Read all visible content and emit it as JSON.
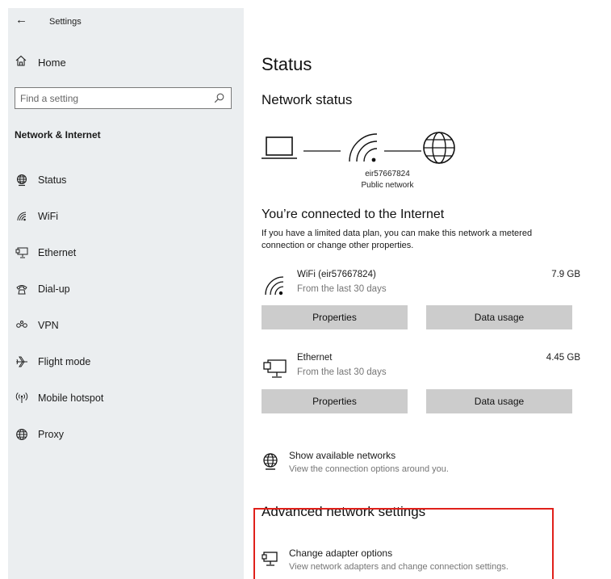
{
  "app": {
    "title": "Settings",
    "accent": "#e0201b"
  },
  "sidebar": {
    "home_label": "Home",
    "search_placeholder": "Find a setting",
    "section_title": "Network & Internet",
    "items": [
      {
        "label": "Status",
        "icon": "globe-status-icon"
      },
      {
        "label": "WiFi",
        "icon": "wifi-icon"
      },
      {
        "label": "Ethernet",
        "icon": "ethernet-icon"
      },
      {
        "label": "Dial-up",
        "icon": "phone-icon"
      },
      {
        "label": "VPN",
        "icon": "vpn-icon"
      },
      {
        "label": "Flight mode",
        "icon": "airplane-icon"
      },
      {
        "label": "Mobile hotspot",
        "icon": "hotspot-icon"
      },
      {
        "label": "Proxy",
        "icon": "globe-icon"
      }
    ]
  },
  "main": {
    "title": "Status",
    "network_status_heading": "Network status",
    "network_name": "eir57667824",
    "network_type": "Public network",
    "connected_heading": "You’re connected to the Internet",
    "connected_desc": "If you have a limited data plan, you can make this network a metered connection or change other properties.",
    "adapters": [
      {
        "name": "WiFi (eir57667824)",
        "sub": "From the last 30 days",
        "size": "7.9 GB",
        "icon": "wifi-icon",
        "properties_label": "Properties",
        "data_usage_label": "Data usage"
      },
      {
        "name": "Ethernet",
        "sub": "From the last 30 days",
        "size": "4.45 GB",
        "icon": "ethernet-icon",
        "properties_label": "Properties",
        "data_usage_label": "Data usage"
      }
    ],
    "show_networks": {
      "title": "Show available networks",
      "sub": "View the connection options around you."
    },
    "advanced_heading": "Advanced network settings",
    "change_adapter": {
      "title": "Change adapter options",
      "sub": "View network adapters and change connection settings."
    }
  }
}
